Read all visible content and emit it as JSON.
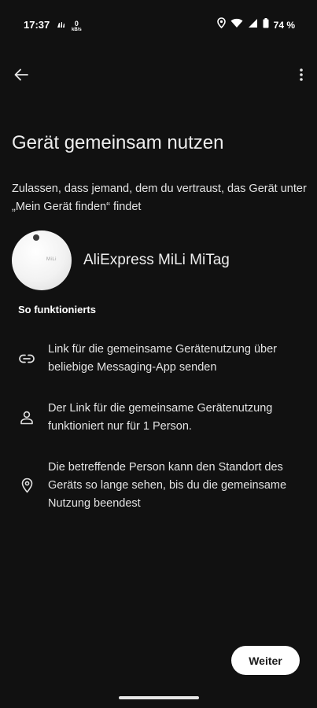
{
  "status_bar": {
    "time": "17:37",
    "net_speed_value": "0",
    "net_speed_unit": "kB/s",
    "battery": "74 %"
  },
  "header": {
    "title": "Gerät gemeinsam nutzen",
    "description": "Zulassen, dass jemand, dem du vertraust, das Gerät unter „Mein Gerät finden“ findet"
  },
  "device": {
    "name": "AliExpress MiLi MiTag",
    "logo_text": "MiLi"
  },
  "how_it_works": {
    "title": "So funktionierts",
    "items": [
      {
        "icon": "link-icon",
        "text": "Link für die gemeinsame Gerätenutzung über beliebige Messaging-App senden"
      },
      {
        "icon": "person-icon",
        "text": "Der Link für die gemeinsame Gerätenutzung funktioniert nur für 1 Person."
      },
      {
        "icon": "location-pin-icon",
        "text": "Die betreffende Person kann den Standort des Geräts so lange sehen, bis du die gemeinsame Nutzung beendest"
      }
    ]
  },
  "actions": {
    "next_label": "Weiter"
  }
}
